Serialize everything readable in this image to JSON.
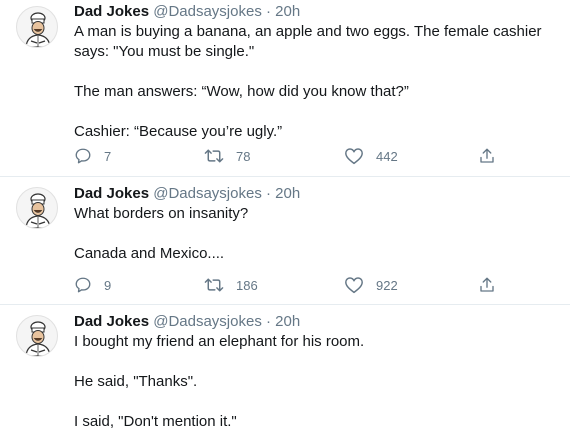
{
  "tweets": [
    {
      "name": "Dad Jokes",
      "handle": "@Dadsaysjokes",
      "dot": "·",
      "time": "20h",
      "paragraphs": [
        "A man is buying a banana, an apple and two eggs. The female cashier says: \"You must be single.\"",
        "The man answers: “Wow, how did you know that?”",
        "Cashier: “Because you’re ugly.”"
      ],
      "replies": "7",
      "retweets": "78",
      "likes": "442"
    },
    {
      "name": "Dad Jokes",
      "handle": "@Dadsaysjokes",
      "dot": "·",
      "time": "20h",
      "paragraphs": [
        "What borders on insanity?",
        "Canada and Mexico...."
      ],
      "replies": "9",
      "retweets": "186",
      "likes": "922"
    },
    {
      "name": "Dad Jokes",
      "handle": "@Dadsaysjokes",
      "dot": "·",
      "time": "20h",
      "paragraphs": [
        "I bought my friend an elephant for his room.",
        "He said, \"Thanks\".",
        "I said, \"Don't mention it.\""
      ]
    }
  ],
  "icons": {
    "reply": "comment-icon",
    "retweet": "retweet-icon",
    "like": "heart-icon",
    "share": "share-icon"
  },
  "colors": {
    "text": "#14171a",
    "muted": "#657786",
    "divider": "#e6ecf0"
  }
}
